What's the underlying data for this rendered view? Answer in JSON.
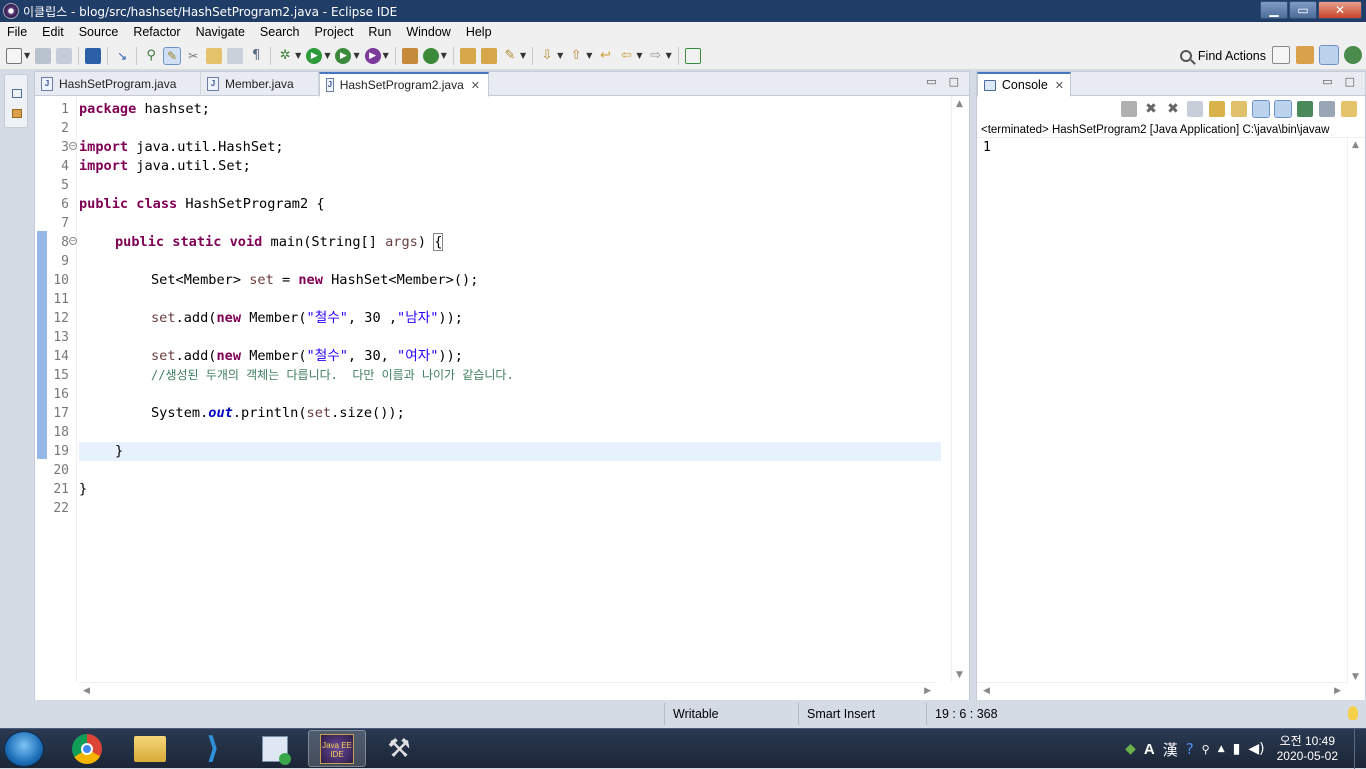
{
  "window": {
    "title": "이클립스 - blog/src/hashset/HashSetProgram2.java - Eclipse IDE",
    "min": "▁",
    "max": "▭",
    "close": "✕"
  },
  "menu": [
    "File",
    "Edit",
    "Source",
    "Refactor",
    "Navigate",
    "Search",
    "Project",
    "Run",
    "Window",
    "Help"
  ],
  "toolbar": {
    "find_actions": "Find Actions"
  },
  "editor": {
    "tabs": [
      {
        "label": "HashSetProgram.java",
        "active": false
      },
      {
        "label": "Member.java",
        "active": false
      },
      {
        "label": "HashSetProgram2.java",
        "active": true
      }
    ],
    "line_numbers": [
      "1",
      "2",
      "3",
      "4",
      "5",
      "6",
      "7",
      "8",
      "9",
      "10",
      "11",
      "12",
      "13",
      "14",
      "15",
      "16",
      "17",
      "18",
      "19",
      "20",
      "21",
      "22"
    ],
    "code": {
      "l1_kw": "package",
      "l1_rest": " hashset;",
      "l3_kw": "import",
      "l3_rest": " java.util.HashSet;",
      "l4_kw": "import",
      "l4_rest": " java.util.Set;",
      "l6_kw": "public class",
      "l6_rest": " HashSetProgram2 {",
      "l8_kw": "public static void",
      "l8_a": " main(String[] ",
      "l8_var": "args",
      "l8_b": ") ",
      "l8_brace": "{",
      "l10_a": "Set<Member> ",
      "l10_var": "set",
      "l10_b": " = ",
      "l10_kw": "new",
      "l10_c": " HashSet<Member>();",
      "l12_var": "set",
      "l12_a": ".add(",
      "l12_kw": "new",
      "l12_b": " Member(",
      "l12_s1": "\"철수\"",
      "l12_c": ", 30 ,",
      "l12_s2": "\"남자\"",
      "l12_d": "));",
      "l14_var": "set",
      "l14_a": ".add(",
      "l14_kw": "new",
      "l14_b": " Member(",
      "l14_s1": "\"철수\"",
      "l14_c": ", 30, ",
      "l14_s2": "\"여자\"",
      "l14_d": "));",
      "l15_cmt": "//생성된 두개의 객체는 다릅니다.  다만 이름과 나이가 같습니다.",
      "l17_a": "System.",
      "l17_fld": "out",
      "l17_b": ".println(",
      "l17_var": "set",
      "l17_c": ".size());",
      "l19": "}",
      "l21": "}"
    }
  },
  "console": {
    "tab_label": "Console",
    "status": "<terminated> HashSetProgram2 [Java Application] C:\\java\\bin\\javaw",
    "output": "1"
  },
  "statusbar": {
    "writable": "Writable",
    "insert_mode": "Smart Insert",
    "position": "19 : 6 : 368"
  },
  "taskbar": {
    "clock_time": "오전 10:49",
    "clock_date": "2020-05-02",
    "ime_a": "A",
    "ime_han": "漢",
    "eclipse_label": "Java EE IDE"
  }
}
